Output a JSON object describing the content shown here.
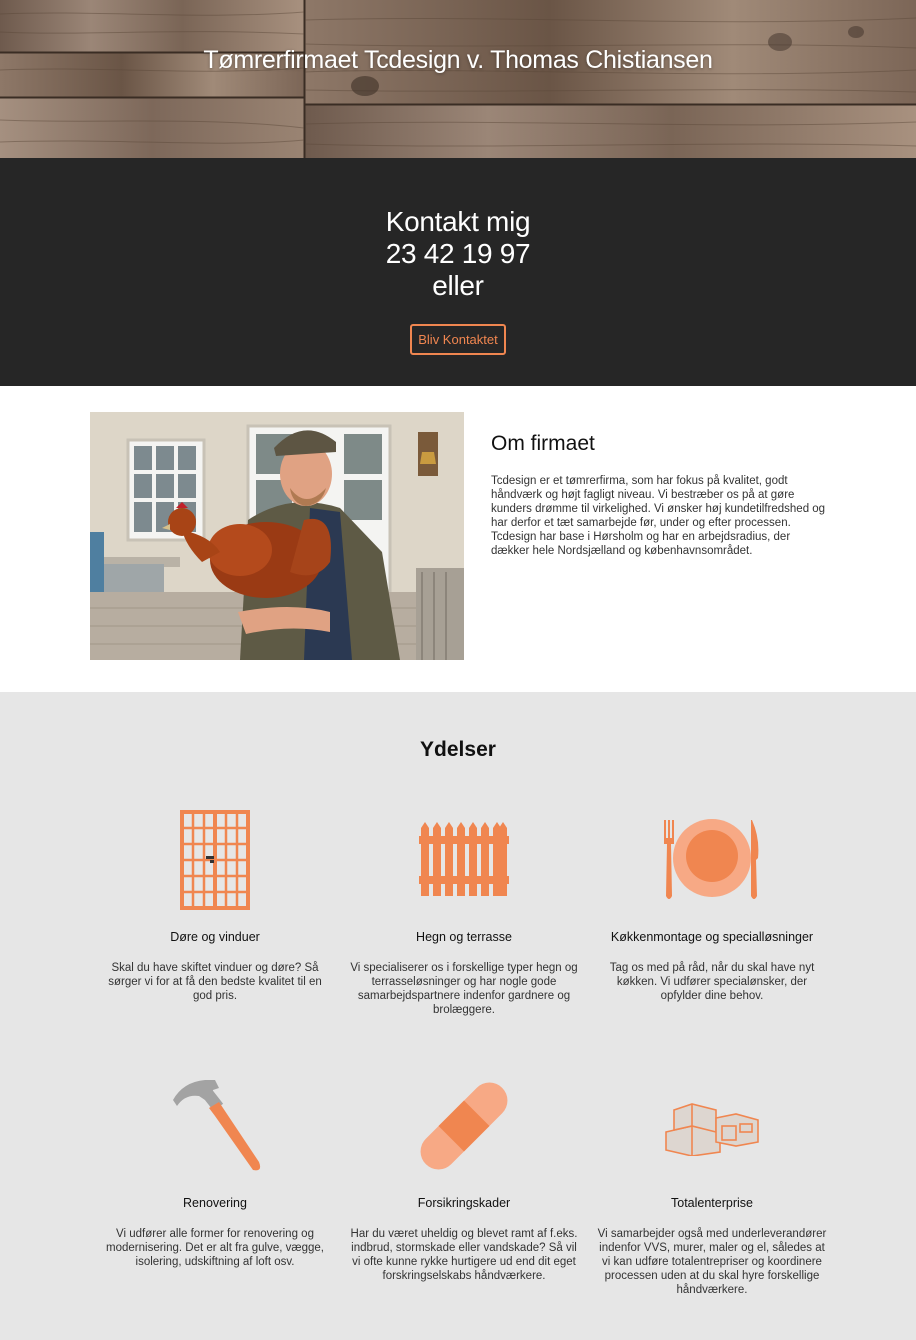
{
  "hero": {
    "title": "Tømrerfirmaet Tcdesign v. Thomas Chistiansen"
  },
  "contact": {
    "line1": "Kontakt mig",
    "line2": "23 42 19 97",
    "line3": "eller",
    "button_label": "Bliv Kontaktet"
  },
  "about": {
    "heading": "Om firmaet",
    "text": "Tcdesign er et tømrerfirma, som har fokus på kvalitet, godt håndværk og højt fagligt niveau. Vi bestræber os på at gøre kunders drømme til virkelighed. Vi ønsker høj kundetilfredshed og har derfor et tæt samarbejde før, under og efter processen. Tcdesign har base i Hørsholm og har en arbejdsradius, der dækker hele Nordsjælland og københavnsområdet."
  },
  "services": {
    "heading": "Ydelser",
    "items": [
      {
        "title": "Døre og vinduer",
        "desc": "Skal du have skiftet vinduer og døre? Så sørger vi for at få den bedste kvalitet til en god pris.",
        "icon": "door-icon"
      },
      {
        "title": "Hegn og terrasse",
        "desc": "Vi specialiserer os i forskellige typer hegn og terrasseløsninger og har nogle gode samarbejdspartnere indenfor gardnere og brolæggere.",
        "icon": "fence-icon"
      },
      {
        "title": "Køkkenmontage og specialløsninger",
        "desc": "Tag os med på råd, når du skal have nyt køkken. Vi udfører specialønsker, der opfylder dine behov.",
        "icon": "plate-cutlery-icon"
      },
      {
        "title": "Renovering",
        "desc": "Vi udfører alle former for renovering og modernisering. Det er alt fra gulve, vægge, isolering, udskiftning af loft osv.",
        "icon": "hammer-icon"
      },
      {
        "title": "Forsikringskader",
        "desc": "Har du været uheldig og blevet ramt af f.eks. indbrud, stormskade eller vandskade? Så vil vi ofte kunne rykke hurtigere ud end dit eget forskringselskabs håndværkere.",
        "icon": "bandage-icon"
      },
      {
        "title": "Totalenterprise",
        "desc": "Vi samarbejder også med underleverandører indenfor VVS, murer, maler og el, således at vi kan udføre totalentrepriser og koordinere processen uden at du skal hyre forskellige håndværkere.",
        "icon": "house-icon"
      }
    ]
  },
  "colors": {
    "accent": "#f08650",
    "dark": "#262626",
    "light_gray": "#e6e6e6"
  }
}
